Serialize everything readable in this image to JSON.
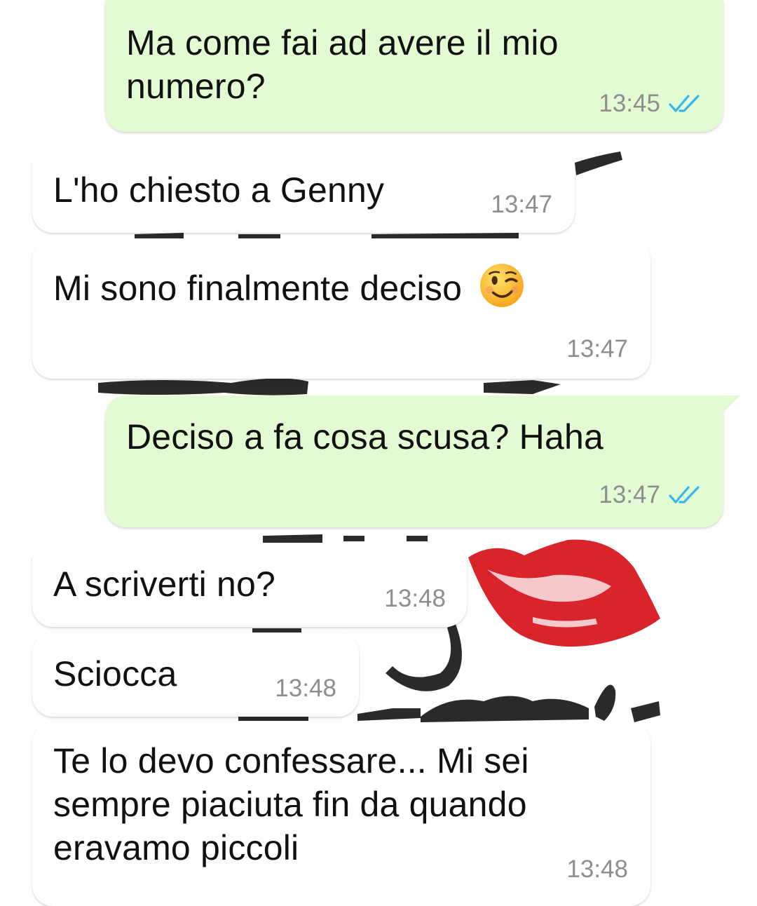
{
  "messages": [
    {
      "direction": "outgoing",
      "lines": [
        "Ma come fai ad avere il mio",
        "numero?"
      ],
      "time": "13:45",
      "status": "read"
    },
    {
      "direction": "incoming",
      "lines": [
        "L'ho chiesto a Genny"
      ],
      "time": "13:47"
    },
    {
      "direction": "incoming",
      "lines": [
        "Mi sono finalmente deciso"
      ],
      "emoji": "winking-face",
      "time": "13:47"
    },
    {
      "direction": "outgoing",
      "lines": [
        "Deciso a fa cosa scusa? Haha"
      ],
      "time": "13:47",
      "status": "read"
    },
    {
      "direction": "incoming",
      "lines": [
        "A scriverti no?"
      ],
      "time": "13:48"
    },
    {
      "direction": "incoming",
      "lines": [
        "Sciocca"
      ],
      "time": "13:48"
    },
    {
      "direction": "incoming",
      "lines": [
        "Te lo devo confessare... Mi sei",
        "sempre piaciuta fin da quando",
        "eravamo piccoli"
      ],
      "time": "13:48"
    }
  ],
  "colors": {
    "outgoing_bubble": "#e2fbd2",
    "incoming_bubble": "#ffffff",
    "timestamp": "#8e8e8e",
    "read_ticks": "#34b7f1",
    "wallpaper_lips": "#d8242a",
    "wallpaper_ink": "#2a2a2a"
  },
  "icons": {
    "read_status": "double-check-icon",
    "emoji": "winking-face-emoji-icon"
  }
}
